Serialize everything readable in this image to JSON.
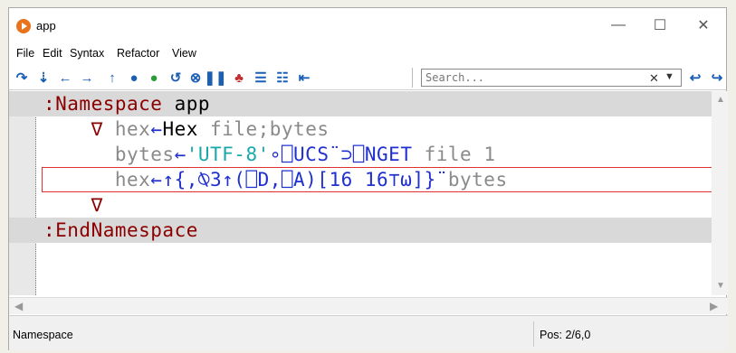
{
  "window": {
    "title": "app"
  },
  "menu": [
    "File",
    "Edit",
    "Syntax",
    "Refactor",
    "View"
  ],
  "toolbar": {
    "search_placeholder": "Search...",
    "buttons": [
      "step-over-icon",
      "step-into-icon",
      "back-icon",
      "forward-icon",
      "step-out-icon",
      "run-icon",
      "continue-icon",
      "restart-icon",
      "stop-icon",
      "pause-icon",
      "trace-off-icon",
      "list-icon",
      "list-indent-icon",
      "back-line-icon",
      "search-prev-icon",
      "search-next-icon"
    ]
  },
  "editor": {
    "lines": [
      [
        {
          "t": ":Namespace ",
          "c": "kw"
        },
        {
          "t": "app",
          "c": "id"
        }
      ],
      [
        {
          "t": "    ",
          "c": "id"
        },
        {
          "t": "∇ ",
          "c": "del"
        },
        {
          "t": "hex",
          "c": "nm"
        },
        {
          "t": "←",
          "c": "fn"
        },
        {
          "t": "Hex",
          "c": "id"
        },
        {
          "t": " file;bytes",
          "c": "nm"
        }
      ],
      [
        {
          "t": "      ",
          "c": "id"
        },
        {
          "t": "bytes",
          "c": "nm"
        },
        {
          "t": "←",
          "c": "fn"
        },
        {
          "t": "'UTF-8'",
          "c": "st"
        },
        {
          "t": "∘⎕UCS¨⊃⎕NGET",
          "c": "fn"
        },
        {
          "t": " file 1",
          "c": "nm"
        }
      ],
      [
        {
          "t": "      ",
          "c": "id"
        },
        {
          "t": "hex",
          "c": "nm"
        },
        {
          "t": "←↑{,⍉3↑(⎕D,⎕A)[16 16⊤⍵]}¨",
          "c": "fn"
        },
        {
          "t": "bytes",
          "c": "nm"
        }
      ],
      [
        {
          "t": "    ",
          "c": "id"
        },
        {
          "t": "∇",
          "c": "del"
        }
      ],
      [
        {
          "t": ":EndNamespace",
          "c": "kw"
        }
      ]
    ]
  },
  "status": {
    "left": "Namespace",
    "pos": "Pos: 2/6,0"
  },
  "colors": {
    "keyword": "#8b0000",
    "name": "#8a8a8a",
    "function": "#2030d0",
    "string": "#1aa7a7",
    "current_line_border": "#e03030"
  }
}
